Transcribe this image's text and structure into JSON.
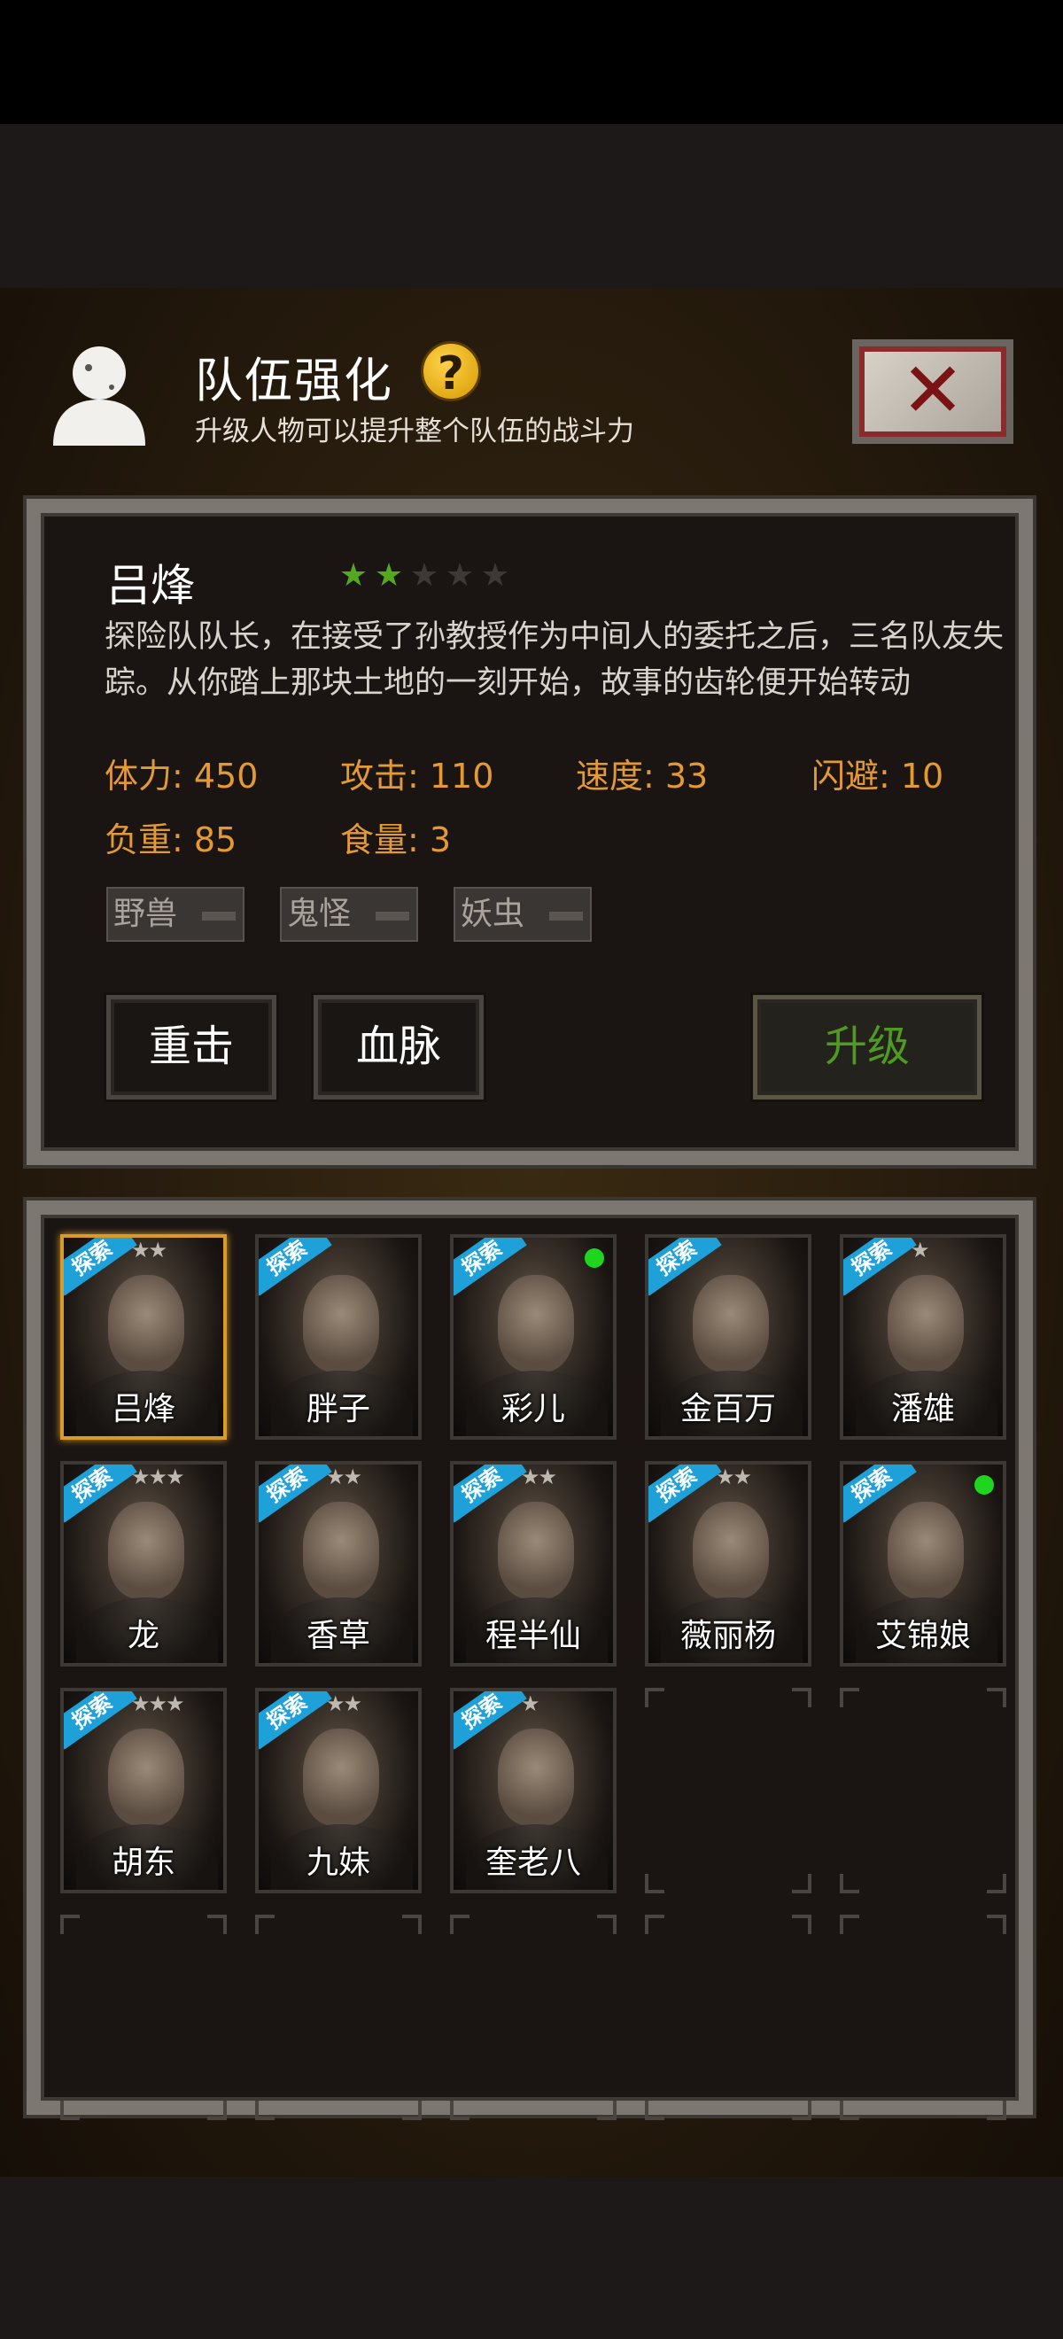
{
  "header": {
    "title": "队伍强化",
    "subtitle": "升级人物可以提升整个队伍的战斗力",
    "help_icon": "question-icon",
    "close_icon": "close-x-icon",
    "close_label": "✕"
  },
  "hero": {
    "name": "吕烽",
    "stars_on": 2,
    "stars_total": 5,
    "description": "探险队队长，在接受了孙教授作为中间人的委托之后，三名队友失踪。从你踏上那块土地的一刻开始，故事的齿轮便开始转动",
    "stats": {
      "hp": "体力: 450",
      "attack": "攻击: 110",
      "speed": "速度: 33",
      "dodge": "闪避: 10",
      "load": "负重: 85",
      "food": "食量: 3"
    },
    "tags": [
      "野兽",
      "鬼怪",
      "妖虫"
    ],
    "skill1": "重击",
    "skill2": "血脉",
    "upgrade": "升级"
  },
  "roster": [
    {
      "name": "吕烽",
      "badge": "探索",
      "stars": "★★",
      "online": false,
      "selected": true
    },
    {
      "name": "胖子",
      "badge": "探索",
      "stars": "",
      "online": false,
      "selected": false
    },
    {
      "name": "彩儿",
      "badge": "探索",
      "stars": "",
      "online": true,
      "selected": false
    },
    {
      "name": "金百万",
      "badge": "探索",
      "stars": "",
      "online": false,
      "selected": false
    },
    {
      "name": "潘雄",
      "badge": "探索",
      "stars": "★",
      "online": false,
      "selected": false
    },
    {
      "name": "龙",
      "badge": "探索",
      "stars": "★★★",
      "online": false,
      "selected": false
    },
    {
      "name": "香草",
      "badge": "探索",
      "stars": "★★",
      "online": false,
      "selected": false
    },
    {
      "name": "程半仙",
      "badge": "探索",
      "stars": "★★",
      "online": false,
      "selected": false
    },
    {
      "name": "薇丽杨",
      "badge": "探索",
      "stars": "★★",
      "online": false,
      "selected": false
    },
    {
      "name": "艾锦娘",
      "badge": "探索",
      "stars": "",
      "online": true,
      "selected": false
    },
    {
      "name": "胡东",
      "badge": "探索",
      "stars": "★★★",
      "online": false,
      "selected": false
    },
    {
      "name": "九妹",
      "badge": "探索",
      "stars": "★★",
      "online": false,
      "selected": false
    },
    {
      "name": "奎老八",
      "badge": "探索",
      "stars": "★",
      "online": false,
      "selected": false
    }
  ]
}
